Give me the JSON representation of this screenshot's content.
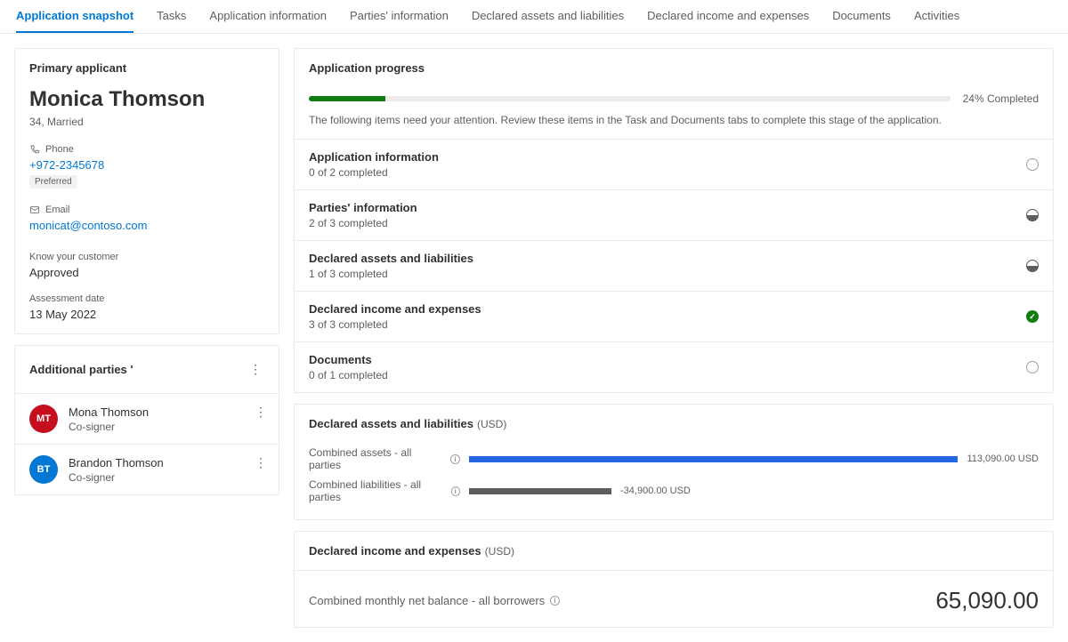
{
  "tabs": {
    "items": [
      {
        "label": "Application snapshot",
        "active": true
      },
      {
        "label": "Tasks",
        "active": false
      },
      {
        "label": "Application information",
        "active": false
      },
      {
        "label": "Parties' information",
        "active": false
      },
      {
        "label": "Declared assets and liabilities",
        "active": false
      },
      {
        "label": "Declared income and expenses",
        "active": false
      },
      {
        "label": "Documents",
        "active": false
      },
      {
        "label": "Activities",
        "active": false
      }
    ]
  },
  "applicant": {
    "card_title": "Primary applicant",
    "name": "Monica Thomson",
    "summary": "34, Married",
    "phone_label": "Phone",
    "phone_value": "+972-2345678",
    "phone_badge": "Preferred",
    "email_label": "Email",
    "email_value": "monicat@contoso.com",
    "kyc_label": "Know your customer",
    "kyc_value": "Approved",
    "assessment_label": "Assessment date",
    "assessment_value": "13 May 2022"
  },
  "additional_parties": {
    "title": "Additional parties '",
    "rows": [
      {
        "initials": "MT",
        "color": "#c50f1f",
        "name": "Mona Thomson",
        "role": "Co-signer"
      },
      {
        "initials": "BT",
        "color": "#0078d4",
        "name": "Brandon Thomson",
        "role": "Co-signer"
      }
    ]
  },
  "progress": {
    "title": "Application progress",
    "percent": 24,
    "percent_label": "24% Completed",
    "hint": "The following items need your attention. Review these items in the Task and Documents tabs to complete this stage of the application.",
    "items": [
      {
        "title": "Application information",
        "sub": "0 of 2 completed",
        "status": "empty"
      },
      {
        "title": "Parties' information",
        "sub": "2 of 3 completed",
        "status": "partial"
      },
      {
        "title": "Declared assets and liabilities",
        "sub": "1 of 3 completed",
        "status": "partial"
      },
      {
        "title": "Declared income and expenses",
        "sub": "3 of 3 completed",
        "status": "complete"
      },
      {
        "title": "Documents",
        "sub": "0 of 1 completed",
        "status": "empty"
      }
    ]
  },
  "assets": {
    "title": "Declared assets and liabilities",
    "currency": "(USD)",
    "rows": [
      {
        "label": "Combined assets - all parties",
        "value": "113,090.00 USD",
        "widthPct": 100,
        "color": "blue"
      },
      {
        "label": "Combined liabilities - all parties",
        "value": "-34,900.00 USD",
        "widthPct": 30,
        "color": "grey"
      }
    ]
  },
  "income": {
    "title": "Declared income and expenses",
    "currency": "(USD)",
    "label": "Combined monthly net balance - all borrowers",
    "value": "65,090.00"
  },
  "chart_data": [
    {
      "type": "bar",
      "title": "Application progress",
      "categories": [
        "progress"
      ],
      "values": [
        24
      ],
      "ylim": [
        0,
        100
      ],
      "xlabel": "",
      "ylabel": "Percent complete"
    },
    {
      "type": "bar",
      "title": "Declared assets and liabilities (USD)",
      "categories": [
        "Combined assets - all parties",
        "Combined liabilities - all parties"
      ],
      "values": [
        113090.0,
        -34900.0
      ],
      "xlabel": "",
      "ylabel": "USD"
    }
  ]
}
